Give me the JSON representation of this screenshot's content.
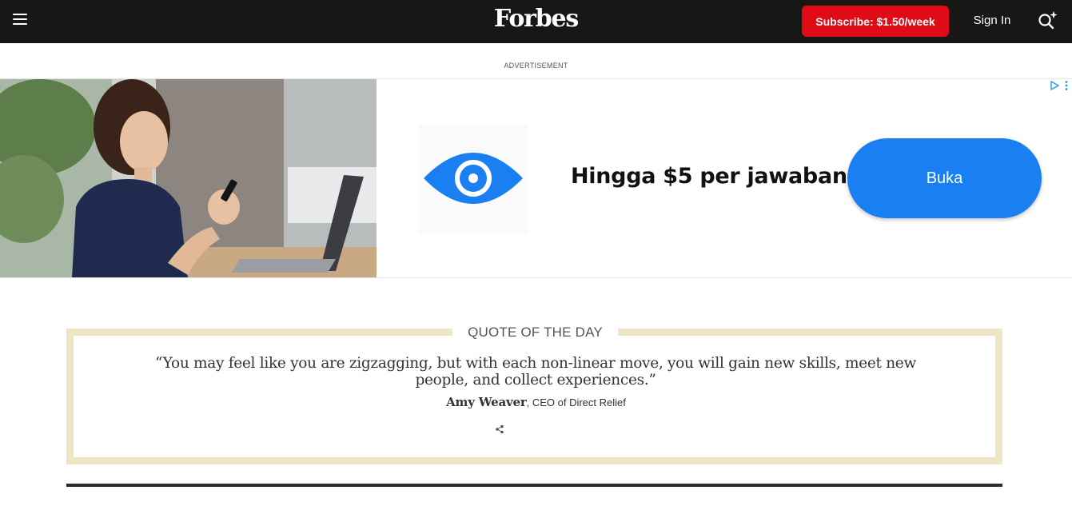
{
  "header": {
    "logo": "Forbes",
    "subscribe_label": "Subscribe: $1.50/week",
    "signin_label": "Sign In",
    "icons": [
      "menu-icon",
      "search-sparkle-icon"
    ],
    "colors": {
      "bar": "#181716",
      "subscribe": "#e00b16"
    }
  },
  "advertisement": {
    "label": "ADVERTISEMENT",
    "headline": "Hingga $5 per jawaban",
    "cta_label": "Buka",
    "icons": [
      "eye-logo-icon",
      "adchoices-icon",
      "ad-menu-icon"
    ],
    "colors": {
      "cta": "#1a7ff0",
      "logo": "#1a7ff0"
    }
  },
  "quote_of_the_day": {
    "label": "QUOTE OF THE DAY",
    "text": "“You may feel like you are zigzagging, but with each non-linear move, you will gain new skills, meet new people, and collect experiences.”",
    "author": "Amy Weaver",
    "author_role": ", CEO of Direct Relief",
    "icons": [
      "share-icon"
    ],
    "colors": {
      "frame": "#ede5c4"
    }
  }
}
